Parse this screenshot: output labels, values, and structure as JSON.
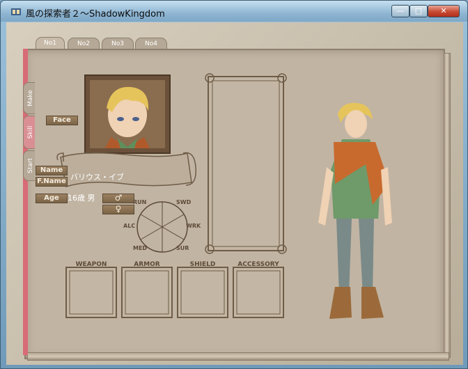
{
  "window": {
    "title": "風の探索者２～ShadowKingdom",
    "min_symbol": "—",
    "max_symbol": "□",
    "close_symbol": "✕"
  },
  "tabs_top": [
    "No1",
    "No2",
    "No3",
    "No4"
  ],
  "tabs_side": [
    "Make",
    "Skill",
    "Start"
  ],
  "labels": {
    "face": "Face",
    "name": "Name",
    "fname": "F.Name",
    "age": "Age"
  },
  "character": {
    "name_value": "バリウス・イブ",
    "age_value": "16歳 男",
    "male_symbol": "♂",
    "female_symbol": "♀"
  },
  "stats": [
    "RUN",
    "SWD",
    "ALC",
    "WRK",
    "MED",
    "SUR"
  ],
  "equipment": [
    "WEAPON",
    "ARMOR",
    "SHIELD",
    "ACCESSORY"
  ],
  "colors": {
    "accent_tab": "#d86b76",
    "label_button": "#8b7154"
  }
}
